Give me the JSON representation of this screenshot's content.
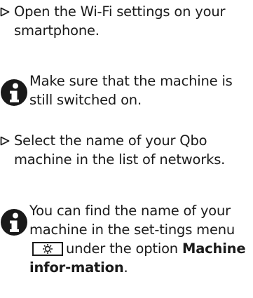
{
  "steps": [
    {
      "text": "Open the Wi-Fi settings on your smartphone."
    },
    {
      "text": "Select the name of your Qbo machine in the list of networks."
    }
  ],
  "notes": [
    {
      "text": "Make sure that the machine is still switched on."
    },
    {
      "part1": "You can find the name of your machine in the set-tings menu",
      "part2": "under the option",
      "bold": "Machine infor-mation",
      "end": "."
    }
  ],
  "icons": {
    "step_marker": "triangle-right-outline-icon",
    "note_marker": "info-icon",
    "settings": "gear-icon"
  }
}
